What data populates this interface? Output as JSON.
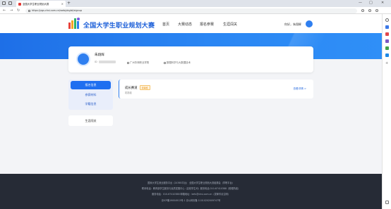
{
  "browser": {
    "tab_title": "全国大学生职业规划大赛",
    "new_tab": "+",
    "url": "https://zgs.chsi.com.cn/web/pkglst/signup",
    "window_controls": [
      "—",
      "□",
      "✕"
    ]
  },
  "header": {
    "logo_text": "全国大学生职业规划大赛",
    "nav": [
      "首页",
      "大赛动态",
      "报名参赛",
      "生涯闯关"
    ],
    "greeting": "你好，朱翔辉"
  },
  "profile": {
    "name": "朱翔辉",
    "id_prefix": "ID",
    "school": "广州华商职业学院",
    "major": "数据科学与大数据技术"
  },
  "sidebar": {
    "items": [
      "报名信息",
      "参赛材料",
      "学籍信息"
    ],
    "item_extra": "生涯闯关"
  },
  "competition": {
    "title": "成长赛道",
    "status": "待审核",
    "subtitle": "初赛组",
    "link": "查看详情 >"
  },
  "footer": {
    "line1": "国家大学生就业服务平台（24365平台）    全国大学生职业规划大赛组委会（学职平台）",
    "line2": "联系电话：教育部学生服务与素质发展中心（高校学生司）服务电话 010-67410388（受理热线）",
    "line3": "服务电话：010-67410388      邮箱地址：kefu@chsi.com.cn（发邮件请注明）",
    "line4": "京ICP备19004913号-1      京公网安备 11010202009747号"
  },
  "colors": {
    "brand_blue": "#1f6ff0",
    "footer_bg": "#262b36",
    "status_orange": "#e78c00"
  }
}
